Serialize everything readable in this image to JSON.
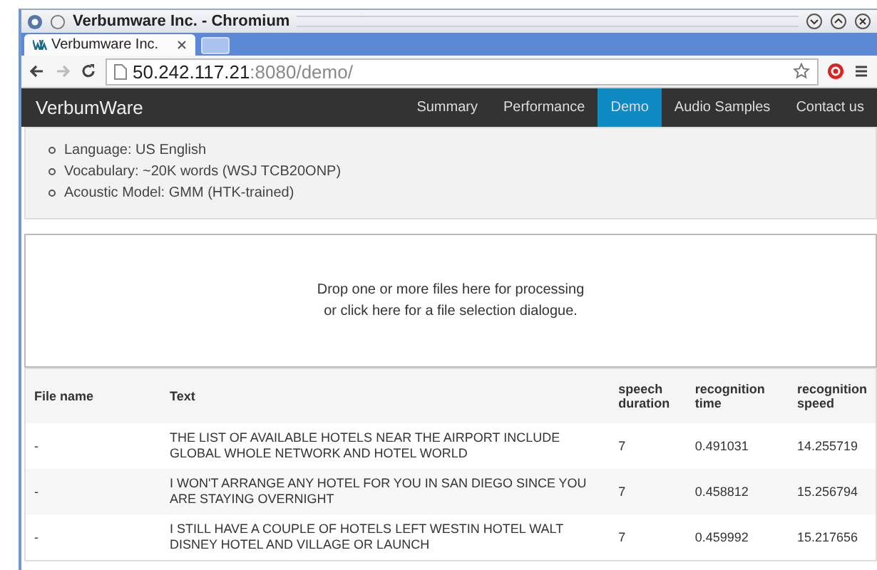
{
  "window": {
    "title": "Verbumware Inc. - Chromium"
  },
  "tabs": [
    {
      "label": "Verbumware Inc.",
      "selected": true
    }
  ],
  "address": {
    "host": "50.242.117.21",
    "path": ":8080/demo/"
  },
  "site": {
    "brand": "VerbumWare",
    "nav": [
      {
        "label": "Summary",
        "selected": false
      },
      {
        "label": "Performance",
        "selected": false
      },
      {
        "label": "Demo",
        "selected": true
      },
      {
        "label": "Audio Samples",
        "selected": false
      },
      {
        "label": "Contact us",
        "selected": false
      }
    ]
  },
  "info": [
    "Language: US English",
    "Vocabulary: ~20K words (WSJ TCB20ONP)",
    "Acoustic Model: GMM (HTK-trained)"
  ],
  "dropzone": [
    "Drop one or more files here for processing",
    "or click here for a file selection dialogue."
  ],
  "table": {
    "columns": [
      "File name",
      "Text",
      "speech duration",
      "recognition time",
      "recognition speed"
    ],
    "rows": [
      [
        "-",
        "THE LIST OF AVAILABLE HOTELS NEAR THE AIRPORT INCLUDE GLOBAL WHOLE NETWORK AND HOTEL WORLD",
        "7",
        "0.491031",
        "14.255719"
      ],
      [
        "-",
        "I WON'T ARRANGE ANY HOTEL FOR YOU IN SAN DIEGO SINCE YOU ARE STAYING OVERNIGHT",
        "7",
        "0.458812",
        "15.256794"
      ],
      [
        "-",
        "I STILL HAVE A COUPLE OF HOTELS LEFT WESTIN HOTEL WALT DISNEY HOTEL AND VILLAGE OR LAUNCH",
        "7",
        "0.459992",
        "15.217656"
      ]
    ]
  }
}
